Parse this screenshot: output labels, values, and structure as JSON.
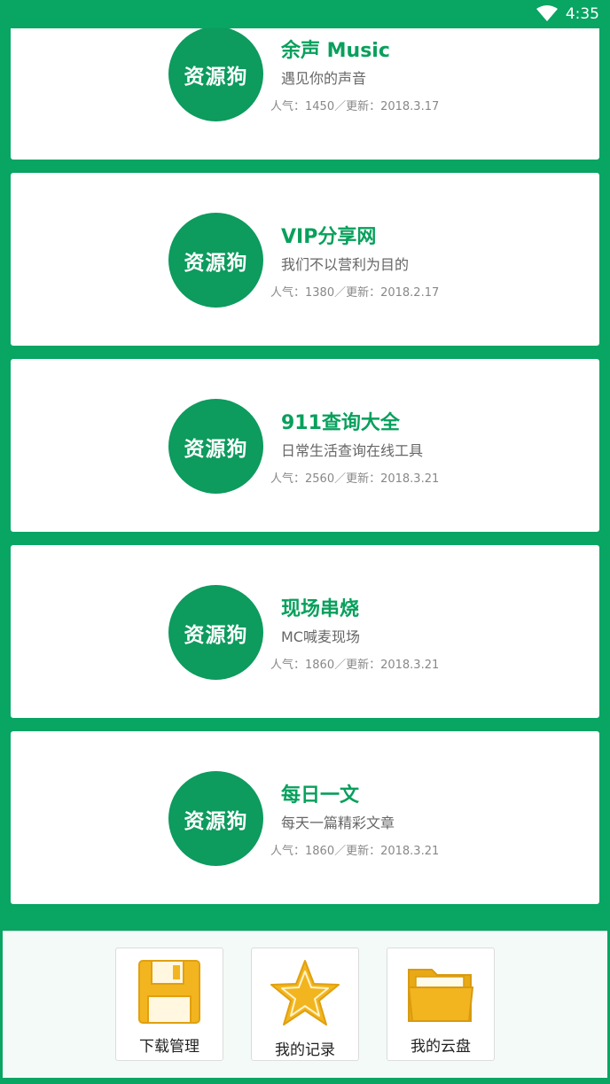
{
  "status": {
    "time": "4:35"
  },
  "avatar_text": "资源狗",
  "cards": [
    {
      "title": "余声 Music",
      "desc": "遇见你的声音",
      "meta": "人气：1450／更新：2018.3.17"
    },
    {
      "title": "VIP分享网",
      "desc": "我们不以营利为目的",
      "meta": "人气：1380／更新：2018.2.17"
    },
    {
      "title": "911查询大全",
      "desc": "日常生活查询在线工具",
      "meta": "人气：2560／更新：2018.3.21"
    },
    {
      "title": "现场串烧",
      "desc": "MC喊麦现场",
      "meta": "人气：1860／更新：2018.3.21"
    },
    {
      "title": "每日一文",
      "desc": " 每天一篇精彩文章",
      "meta": "人气：1860／更新：2018.3.21"
    }
  ],
  "bottom": {
    "tabs": [
      {
        "label": "下载管理",
        "icon": "floppy-disk-icon"
      },
      {
        "label": "我的记录",
        "icon": "star-icon"
      },
      {
        "label": "我的云盘",
        "icon": "folder-icon"
      }
    ]
  },
  "colors": {
    "brand_green": "#08a563",
    "avatar_green": "#0d9b5e",
    "icon_yellow": "#f2b51f"
  }
}
